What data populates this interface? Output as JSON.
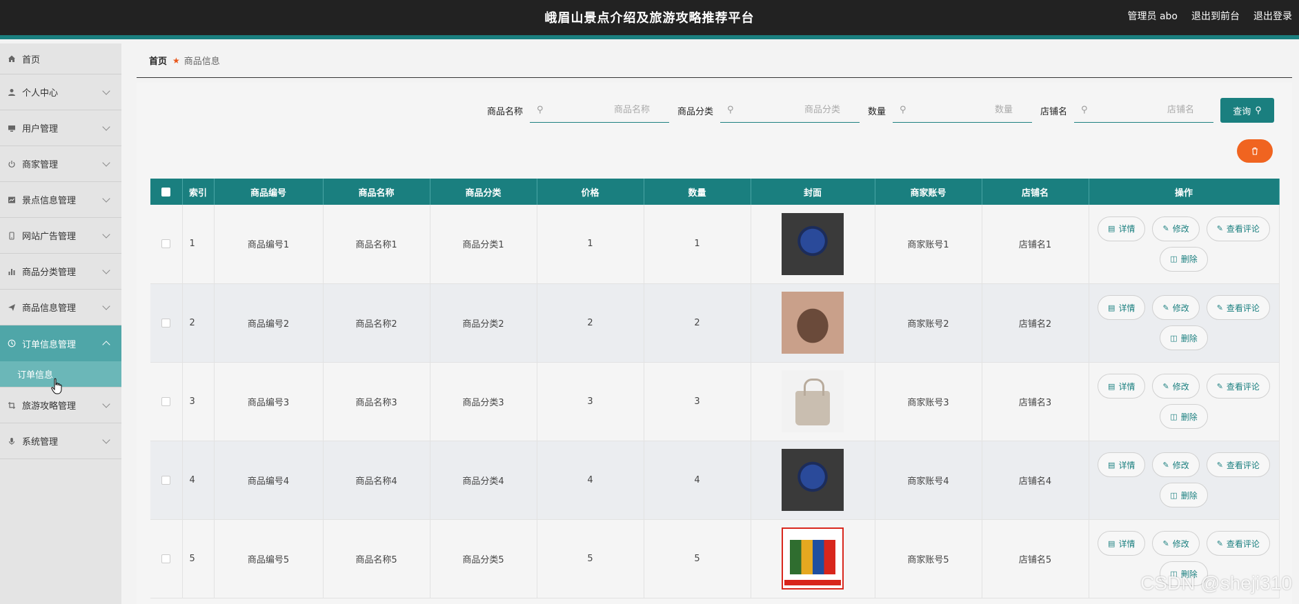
{
  "header": {
    "title": "峨眉山景点介绍及旅游攻略推荐平台",
    "user": "管理员 abo",
    "exit_front": "退出到前台",
    "logout": "退出登录"
  },
  "sidebar": {
    "items": [
      {
        "label": "首页",
        "icon": "home-icon"
      },
      {
        "label": "个人中心",
        "icon": "user-icon"
      },
      {
        "label": "用户管理",
        "icon": "monitor-icon"
      },
      {
        "label": "商家管理",
        "icon": "power-icon"
      },
      {
        "label": "景点信息管理",
        "icon": "chart-icon"
      },
      {
        "label": "网站广告管理",
        "icon": "phone-icon"
      },
      {
        "label": "商品分类管理",
        "icon": "bar-chart-icon"
      },
      {
        "label": "商品信息管理",
        "icon": "send-icon"
      },
      {
        "label": "订单信息管理",
        "icon": "clock-icon"
      },
      {
        "label": "旅游攻略管理",
        "icon": "crop-icon"
      },
      {
        "label": "系统管理",
        "icon": "mic-icon"
      }
    ],
    "sub_item": "订单信息"
  },
  "breadcrumb": {
    "home": "首页",
    "current": "商品信息"
  },
  "search": {
    "fields": [
      {
        "label": "商品名称",
        "placeholder": "商品名称"
      },
      {
        "label": "商品分类",
        "placeholder": "商品分类"
      },
      {
        "label": "数量",
        "placeholder": "数量"
      },
      {
        "label": "店铺名",
        "placeholder": "店铺名"
      }
    ],
    "query_label": "查询"
  },
  "table": {
    "headers": [
      "索引",
      "商品编号",
      "商品名称",
      "商品分类",
      "价格",
      "数量",
      "封面",
      "商家账号",
      "店铺名",
      "操作"
    ],
    "rows": [
      {
        "idx": "1",
        "code": "商品编号1",
        "name": "商品名称1",
        "cat": "商品分类1",
        "price": "1",
        "qty": "1",
        "cover": "watch",
        "account": "商家账号1",
        "shop": "店铺名1"
      },
      {
        "idx": "2",
        "code": "商品编号2",
        "name": "商品名称2",
        "cat": "商品分类2",
        "price": "2",
        "qty": "2",
        "cover": "bag1",
        "account": "商家账号2",
        "shop": "店铺名2"
      },
      {
        "idx": "3",
        "code": "商品编号3",
        "name": "商品名称3",
        "cat": "商品分类3",
        "price": "3",
        "qty": "3",
        "cover": "bag2",
        "account": "商家账号3",
        "shop": "店铺名3"
      },
      {
        "idx": "4",
        "code": "商品编号4",
        "name": "商品名称4",
        "cat": "商品分类4",
        "price": "4",
        "qty": "4",
        "cover": "watch",
        "account": "商家账号4",
        "shop": "店铺名4"
      },
      {
        "idx": "5",
        "code": "商品编号5",
        "name": "商品名称5",
        "cat": "商品分类5",
        "price": "5",
        "qty": "5",
        "cover": "snack",
        "account": "商家账号5",
        "shop": "店铺名5"
      }
    ],
    "ops": {
      "detail": "详情",
      "edit": "修改",
      "comments": "查看评论",
      "delete": "删除"
    }
  },
  "watermark": "CSDN @sheji310",
  "colors": {
    "primary": "#1a7f7f",
    "danger": "#f06420",
    "header_bg": "#222222"
  }
}
